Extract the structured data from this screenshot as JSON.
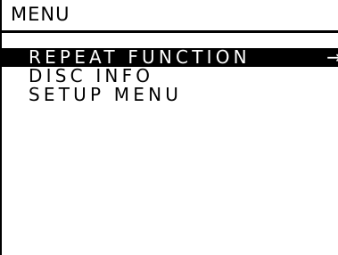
{
  "menu": {
    "title": "MENU",
    "items": [
      {
        "label": "REPEAT FUNCTION",
        "selected": true,
        "arrow": "→"
      },
      {
        "label": "DISC INFO",
        "selected": false
      },
      {
        "label": "SETUP MENU",
        "selected": false
      }
    ]
  },
  "colors": {
    "background": "#ffffff",
    "foreground": "#000000",
    "highlight": "#000000",
    "highlight_text": "#ffffff"
  }
}
